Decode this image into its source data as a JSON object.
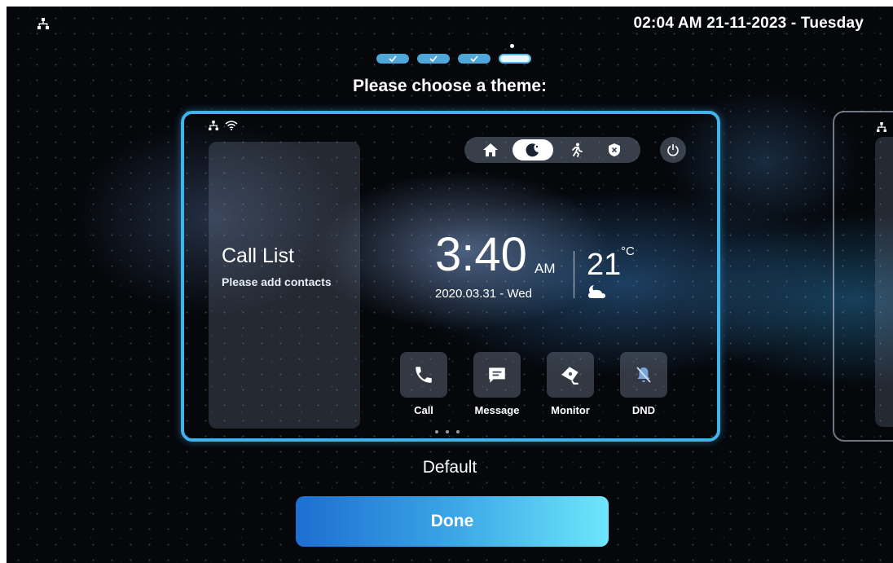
{
  "status_bar": {
    "network_icon": "network-icon",
    "datetime": "02:04 AM  21-11-2023 - Tuesday"
  },
  "progress": {
    "steps_total": 4,
    "steps_completed": 3,
    "completed_icon": "check-icon"
  },
  "prompt": "Please choose a theme:",
  "theme_preview": {
    "status_icons": [
      "network-icon",
      "wifi-icon"
    ],
    "call_list": {
      "title": "Call List",
      "subtitle": "Please add contacts"
    },
    "modes": [
      {
        "icon": "home-icon",
        "active": false
      },
      {
        "icon": "moon-icon",
        "active": true
      },
      {
        "icon": "running-person-icon",
        "active": false
      },
      {
        "icon": "shield-x-icon",
        "active": false
      }
    ],
    "power_icon": "power-icon",
    "time": "3:40",
    "ampm": "AM",
    "date": "2020.03.31 - Wed",
    "temperature": "21",
    "temperature_unit": "°C",
    "weather_icon": "partly-cloudy-night-icon",
    "apps": [
      {
        "label": "Call",
        "icon": "phone-icon"
      },
      {
        "label": "Message",
        "icon": "message-icon"
      },
      {
        "label": "Monitor",
        "icon": "camera-icon"
      },
      {
        "label": "DND",
        "icon": "bell-off-icon"
      }
    ],
    "pages": 3
  },
  "theme_name": "Default",
  "done_label": "Done",
  "colors": {
    "accent": "#3fb3ea",
    "button_start": "#1d6ed0",
    "button_end": "#6ee6fb",
    "background": "#05070b"
  }
}
